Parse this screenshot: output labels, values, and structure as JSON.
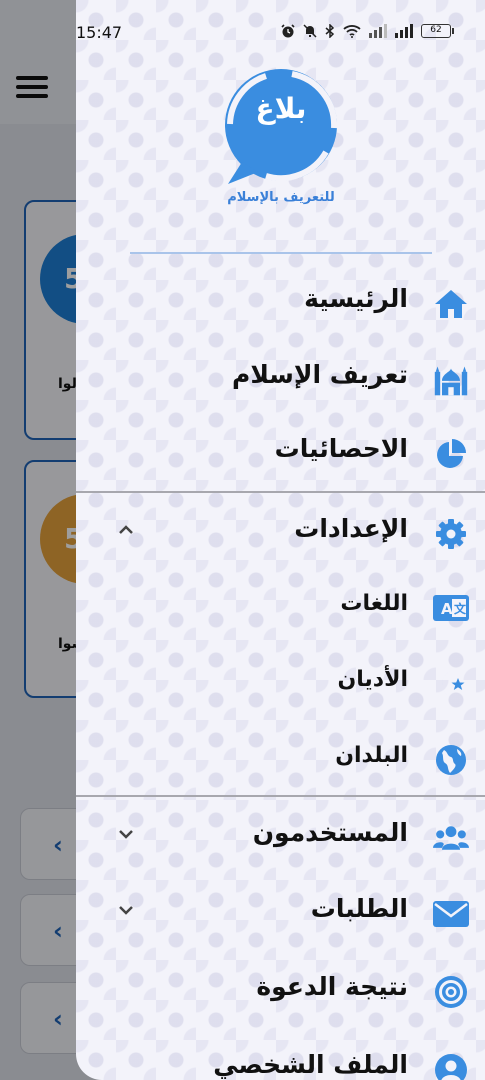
{
  "status_bar": {
    "time": "15:47",
    "battery": "62"
  },
  "background": {
    "card1_number": "5",
    "card1_text": "لوا",
    "card2_number": "5",
    "card2_text": "ضوا",
    "card1_color": "#1d7fd6",
    "card2_color": "#e6a23c"
  },
  "logo": {
    "word": "بلاغ",
    "tagline": "للتعريف بالإسلام"
  },
  "menu": {
    "home": "الرئيسية",
    "islam": "تعريف الإسلام",
    "stats": "الاحصائيات",
    "settings": "الإعدادات",
    "languages": "اللغات",
    "religions": "الأديان",
    "countries": "البلدان",
    "users": "المستخدمون",
    "requests": "الطلبات",
    "outcome": "نتيجة الدعوة",
    "profile": "الملف الشخصي"
  },
  "icons": {
    "home": "home-icon",
    "islam": "mosque-icon",
    "stats": "pie-chart-icon",
    "settings": "gear-icon",
    "languages": "language-icon",
    "religions": "crescent-star-icon",
    "countries": "globe-icon",
    "users": "users-icon",
    "requests": "envelope-icon",
    "outcome": "target-icon",
    "profile": "user-circle-icon"
  },
  "colors": {
    "accent": "#3a8de0",
    "text": "#111111",
    "drawer_bg": "#f3f3fa"
  }
}
